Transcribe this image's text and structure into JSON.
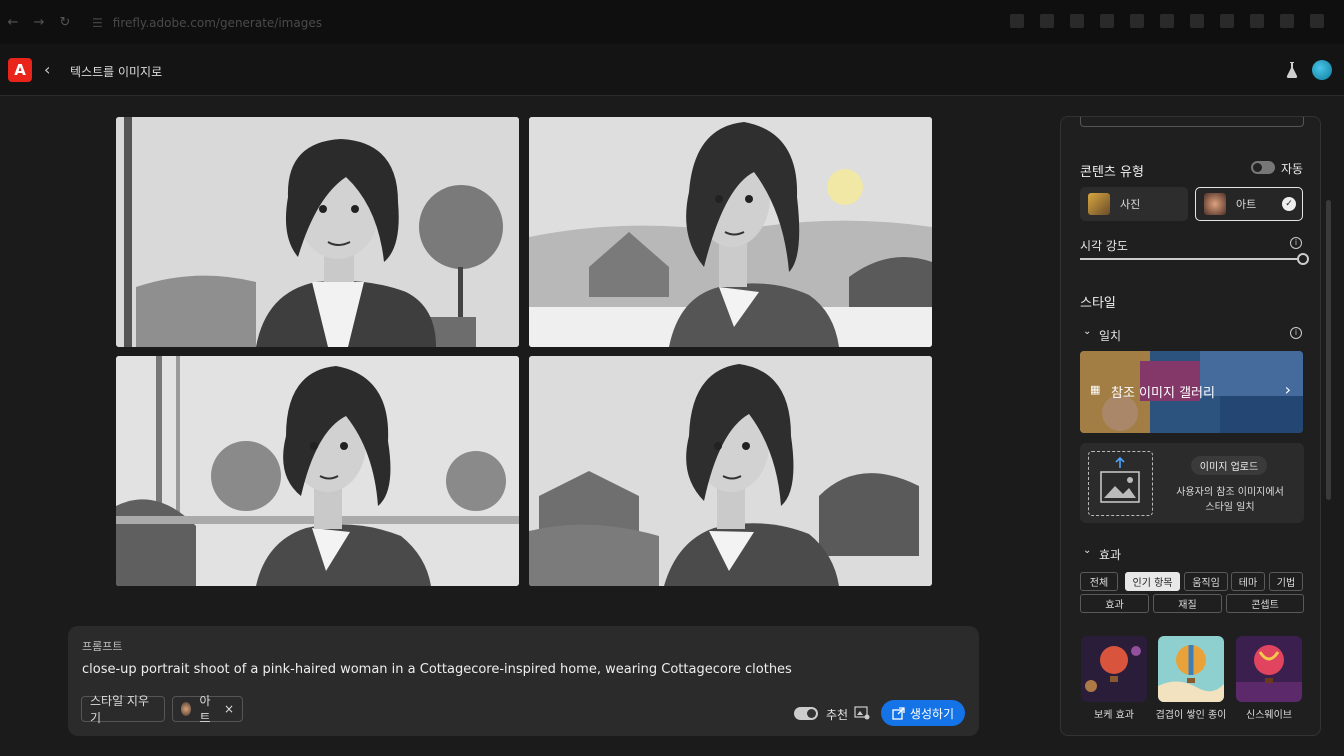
{
  "browser": {
    "url": "firefly.adobe.com/generate/images"
  },
  "header": {
    "title": "텍스트를 이미지로"
  },
  "images": [
    {
      "name": "portrait-1"
    },
    {
      "name": "portrait-2"
    },
    {
      "name": "portrait-3"
    },
    {
      "name": "portrait-4"
    }
  ],
  "prompt": {
    "label": "프롬프트",
    "text": "close-up portrait shoot of a pink-haired woman in a Cottagecore-inspired home, wearing Cottagecore clothes",
    "clear_style_label": "스타일 지우기",
    "chip_label": "아트",
    "chip_remove": "×",
    "suggest_label": "추천",
    "generate_label": "생성하기"
  },
  "panel": {
    "content_type": {
      "heading": "콘텐츠 유형",
      "auto_label": "자동",
      "options": [
        {
          "label": "사진",
          "selected": false
        },
        {
          "label": "아트",
          "selected": true
        }
      ]
    },
    "visual_intensity": {
      "label": "시각 강도",
      "value": 1.0
    },
    "style": {
      "heading": "스타일",
      "match_heading": "일치",
      "gallery_label": "참조 이미지 갤러리",
      "upload_button": "이미지 업로드",
      "upload_desc_1": "사용자의 참조 이미지에서",
      "upload_desc_2": "스타일 일치"
    },
    "effects": {
      "heading": "효과",
      "filters_row1": [
        "전체",
        "인기 항목",
        "움직임",
        "테마",
        "기법"
      ],
      "filters_row2": [
        "효과",
        "재질",
        "콘셉트"
      ],
      "selected_filter": "인기 항목",
      "items": [
        "보케 효과",
        "겹겹이 쌓인 종이",
        "신스웨이브"
      ]
    }
  },
  "colors": {
    "accent": "#1473e6",
    "brand": "#e8241b",
    "background": "#1b1b1b"
  }
}
